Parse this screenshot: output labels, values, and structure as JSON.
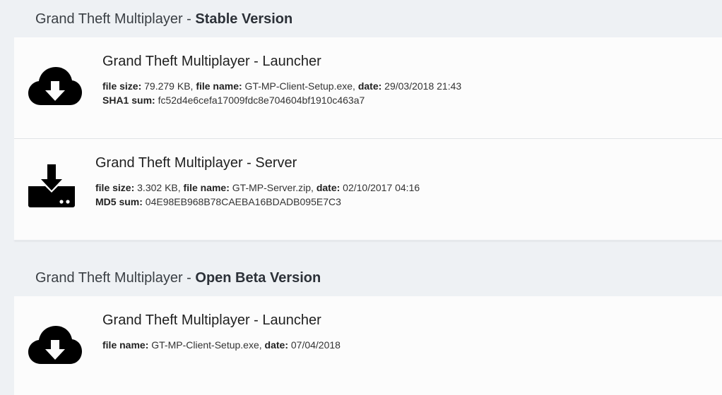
{
  "sections": [
    {
      "title_prefix": "Grand Theft Multiplayer - ",
      "title_strong": "Stable Version",
      "items": [
        {
          "icon": "cloud-download-icon",
          "title": "Grand Theft Multiplayer - Launcher",
          "size_label": "file size:",
          "size_value": " 79.279 KB, ",
          "name_label": "file name:",
          "name_value": " GT-MP-Client-Setup.exe, ",
          "date_label": "date:",
          "date_value": " 29/03/2018 21:43",
          "sum_label": "SHA1 sum:",
          "sum_value": " fc52d4e6cefa17009fdc8e704604bf1910c463a7"
        },
        {
          "icon": "server-download-icon",
          "title": "Grand Theft Multiplayer - Server",
          "size_label": "file size:",
          "size_value": " 3.302 KB, ",
          "name_label": "file name:",
          "name_value": " GT-MP-Server.zip, ",
          "date_label": "date:",
          "date_value": " 02/10/2017 04:16",
          "sum_label": "MD5 sum:",
          "sum_value": " 04E98EB968B78CAEBA16BDADB095E7C3"
        }
      ]
    },
    {
      "title_prefix": "Grand Theft Multiplayer - ",
      "title_strong": "Open Beta Version",
      "items": [
        {
          "icon": "cloud-download-icon",
          "title": "Grand Theft Multiplayer - Launcher",
          "name_label": "file name:",
          "name_value": " GT-MP-Client-Setup.exe, ",
          "date_label": "date:",
          "date_value": " 07/04/2018"
        }
      ]
    }
  ],
  "colors": {
    "background": "#eef1f4",
    "card": "#fcfcfc",
    "icon": "#000000"
  }
}
